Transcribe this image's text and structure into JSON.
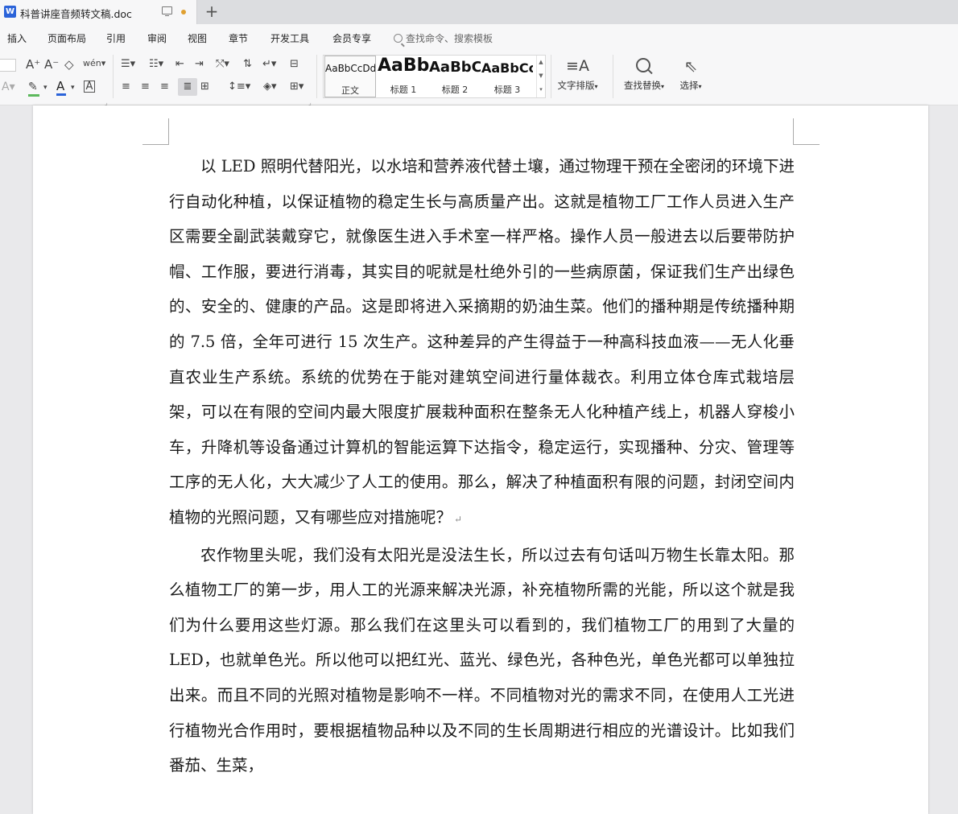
{
  "tab": {
    "logo": "W",
    "title": "科普讲座音频转文稿.doc",
    "new_tab": "+"
  },
  "menu": {
    "items": [
      "插入",
      "页面布局",
      "引用",
      "审阅",
      "视图",
      "章节",
      "开发工具",
      "会员专享"
    ],
    "search_placeholder": "查找命令、搜索模板"
  },
  "toolbar": {
    "styles": [
      {
        "sample": "AaBbCcDd",
        "name": "正文",
        "selected": true
      },
      {
        "sample": "AaBb",
        "name": "标题 1"
      },
      {
        "sample": "AaBbC",
        "name": "标题 2"
      },
      {
        "sample": "AaBbCc",
        "name": "标题 3"
      }
    ],
    "text_layout_label": "文字排版",
    "find_replace_label": "查找替换",
    "select_label": "选择"
  },
  "document": {
    "paragraphs": [
      "以 LED 照明代替阳光，以水培和营养液代替土壤，通过物理干预在全密闭的环境下进行自动化种植，以保证植物的稳定生长与高质量产出。这就是植物工厂工作人员进入生产区需要全副武装戴穿它，就像医生进入手术室一样严格。操作人员一般进去以后要带防护帽、工作服，要进行消毒，其实目的呢就是杜绝外引的一些病原菌，保证我们生产出绿色的、安全的、健康的产品。这是即将进入采摘期的奶油生菜。他们的播种期是传统播种期的 7.5 倍，全年可进行 15 次生产。这种差异的产生得益于一种高科技血液——无人化垂直农业生产系统。系统的优势在于能对建筑空间进行量体裁衣。利用立体仓库式栽培层架，可以在有限的空间内最大限度扩展栽种面积在整条无人化种植产线上，机器人穿梭小车，升降机等设备通过计算机的智能运算下达指令，稳定运行，实现播种、分灾、管理等工序的无人化，大大减少了人工的使用。那么，解决了种植面积有限的问题，封闭空间内植物的光照问题，又有哪些应对措施呢？",
      "农作物里头呢，我们没有太阳光是没法生长，所以过去有句话叫万物生长靠太阳。那么植物工厂的第一步，用人工的光源来解决光源，补充植物所需的光能，所以这个就是我们为什么要用这些灯源。那么我们在这里头可以看到的，我们植物工厂的用到了大量的 LED，也就单色光。所以他可以把红光、蓝光、绿色光，各种色光，单色光都可以单独拉出来。而且不同的光照对植物是影响不一样。不同植物对光的需求不同，在使用人工光进行植物光合作用时，要根据植物品种以及不同的生长周期进行相应的光谱设计。比如我们番茄、生菜，"
    ],
    "paragraph_mark": "↵"
  },
  "colors": {
    "accent": "#2b63d9",
    "unsaved_dot": "#e0a030",
    "highlight_green": "#5cb85c",
    "font_color_blue": "#2b63d9"
  }
}
